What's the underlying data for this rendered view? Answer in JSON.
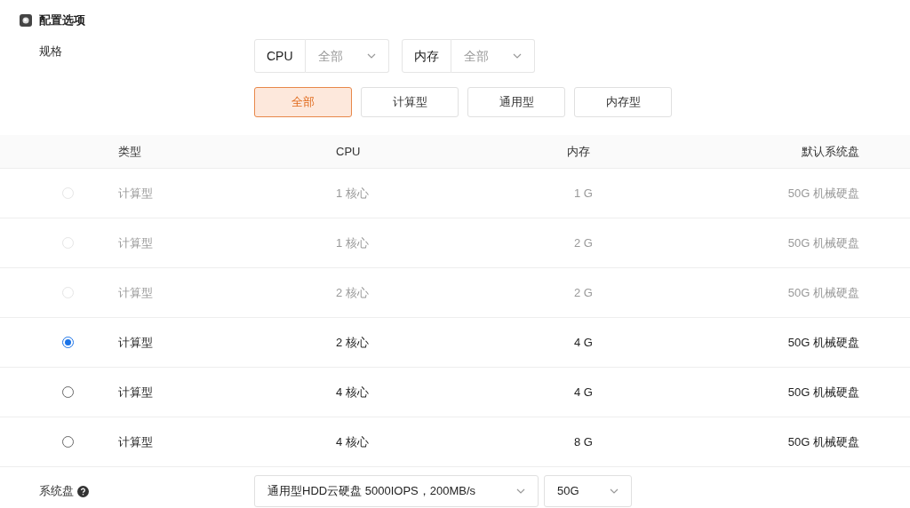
{
  "section": {
    "title": "配置选项"
  },
  "spec": {
    "label": "规格",
    "filters": [
      {
        "label": "CPU",
        "value": "全部"
      },
      {
        "label": "内存",
        "value": "全部"
      }
    ],
    "types": [
      {
        "label": "全部",
        "selected": true
      },
      {
        "label": "计算型",
        "selected": false
      },
      {
        "label": "通用型",
        "selected": false
      },
      {
        "label": "内存型",
        "selected": false
      }
    ]
  },
  "table": {
    "columns": [
      "类型",
      "CPU",
      "内存",
      "默认系统盘"
    ],
    "rows": [
      {
        "type": "计算型",
        "cpu": "1 核心",
        "memory": "1 G",
        "disk": "50G 机械硬盘",
        "disabled": true,
        "selected": false
      },
      {
        "type": "计算型",
        "cpu": "1 核心",
        "memory": "2 G",
        "disk": "50G 机械硬盘",
        "disabled": true,
        "selected": false
      },
      {
        "type": "计算型",
        "cpu": "2 核心",
        "memory": "2 G",
        "disk": "50G 机械硬盘",
        "disabled": true,
        "selected": false
      },
      {
        "type": "计算型",
        "cpu": "2 核心",
        "memory": "4 G",
        "disk": "50G 机械硬盘",
        "disabled": false,
        "selected": true
      },
      {
        "type": "计算型",
        "cpu": "4 核心",
        "memory": "4 G",
        "disk": "50G 机械硬盘",
        "disabled": false,
        "selected": false
      },
      {
        "type": "计算型",
        "cpu": "4 核心",
        "memory": "8 G",
        "disk": "50G 机械硬盘",
        "disabled": false,
        "selected": false
      }
    ]
  },
  "system_disk": {
    "label": "系统盘",
    "disk_type": "通用型HDD云硬盘 5000IOPS，200MB/s",
    "size": "50G"
  }
}
